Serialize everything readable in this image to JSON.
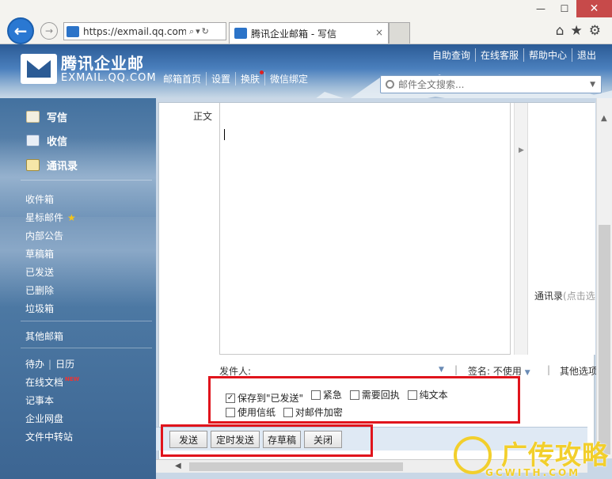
{
  "browser": {
    "url": "https://exmail.qq.com/",
    "tab_title": "腾讯企业邮箱 - 写信",
    "tab_close": "×",
    "win_min": "—",
    "win_max": "☐",
    "win_close": "✕"
  },
  "header": {
    "logo_cn": "腾讯企业邮",
    "logo_en": "EXMAIL.QQ.COM",
    "top_links": [
      "自助查询",
      "在线客服",
      "帮助中心",
      "退出"
    ],
    "nav": [
      "邮箱首页",
      "设置",
      "换肤",
      "微信绑定"
    ],
    "search_placeholder": "邮件全文搜索..."
  },
  "sidebar": {
    "quick": [
      {
        "label": "写信",
        "icon": "compose-icon"
      },
      {
        "label": "收信",
        "icon": "inbox-icon"
      },
      {
        "label": "通讯录",
        "icon": "contacts-icon"
      }
    ],
    "folders": [
      "收件箱",
      "星标邮件",
      "内部公告",
      "草稿箱",
      "已发送",
      "已删除",
      "垃圾箱"
    ],
    "other_mailbox": "其他邮箱",
    "apps": [
      "待办",
      "日历",
      "在线文档",
      "记事本",
      "企业网盘",
      "文件中转站"
    ],
    "new_badge": "NEW"
  },
  "compose": {
    "body_label": "正文",
    "contacts_tab": "通讯录",
    "contacts_hint": "(点击选",
    "sender_label": "发件人:",
    "signature_label": "签名:",
    "signature_value": "不使用",
    "other_options": "其他选项",
    "options": [
      {
        "label": "保存到\"已发送\"",
        "checked": true
      },
      {
        "label": "紧急",
        "checked": false
      },
      {
        "label": "需要回执",
        "checked": false
      },
      {
        "label": "纯文本",
        "checked": false
      },
      {
        "label": "使用信纸",
        "checked": false
      },
      {
        "label": "对邮件加密",
        "checked": false
      }
    ]
  },
  "toolbar": {
    "send": "发送",
    "schedule": "定时发送",
    "save_draft": "存草稿",
    "close": "关闭"
  },
  "watermark": {
    "text": "广传攻略",
    "sub": "GCWITH.COM"
  }
}
